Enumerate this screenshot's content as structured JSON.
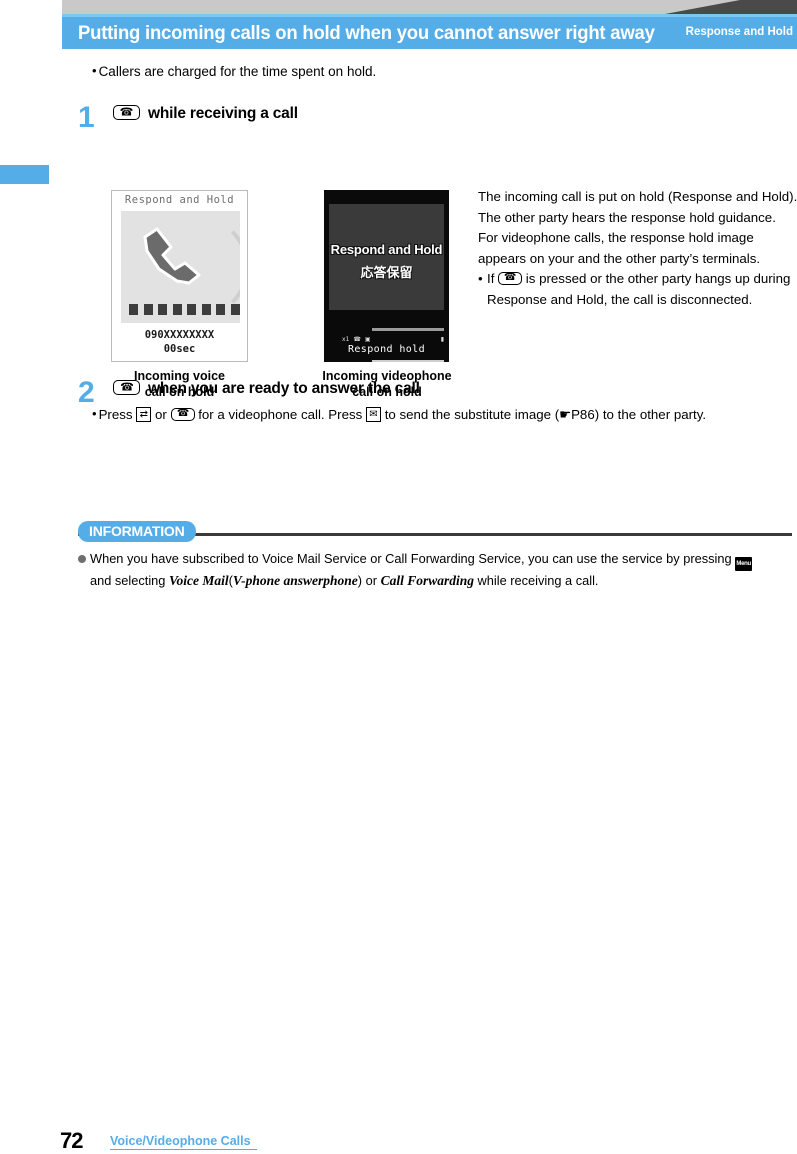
{
  "header": {
    "title": "Putting incoming calls on hold when you cannot answer right away",
    "section_label": "Response and Hold"
  },
  "intro": {
    "bullet": "Callers are charged for the time spent on hold."
  },
  "steps": [
    {
      "number": "1",
      "key_icon": "phone-offhook-key-icon",
      "heading": "while receiving a call"
    },
    {
      "number": "2",
      "key_icon": "phone-answer-key-icon",
      "heading": "when you are ready to answer the call",
      "note_parts": {
        "p1": "Press",
        "p2": "or",
        "p3": "for a videophone call. Press",
        "p4": "to send the substitute image (",
        "ref": "P86",
        "p5": ") to the other party."
      }
    }
  ],
  "screenshots": {
    "voice": {
      "status_title": "Respond and Hold",
      "number": "090XXXXXXXX",
      "duration": "00sec",
      "block_count": 8,
      "caption_line1": "Incoming voice",
      "caption_line2": "call on hold"
    },
    "videophone": {
      "text_en": "Respond and Hold",
      "text_jp": "応答保留",
      "softkey": "Respond hold",
      "status_icons": "x1",
      "caption_line1": "Incoming videophone",
      "caption_line2": "call on hold"
    }
  },
  "right_text": {
    "para1": "The incoming call is put on hold (Response and Hold). The other party hears the response hold guidance.",
    "para2": "For videophone calls, the response hold image appears on your and the other party’s terminals.",
    "bullet_pre": "If",
    "bullet_post": "is pressed or the other party hangs up during Response and Hold, the call is disconnected."
  },
  "information": {
    "tag": "INFORMATION",
    "item_pre": "When you have subscribed to Voice Mail Service or Call Forwarding Service, you can use the service by pressing",
    "menu_key_label": "Menu",
    "item_mid": "and selecting",
    "em1": "Voice Mail",
    "paren_open": "(",
    "em2": "V-phone answerphone",
    "paren_close": ")",
    "item_or": "or",
    "em3": "Call Forwarding",
    "item_end": "while receiving a call."
  },
  "footer": {
    "page_number": "72",
    "chapter": "Voice/Videophone Calls"
  },
  "colors": {
    "accent_blue": "#55ade8",
    "band_gray": "#c9c9c9",
    "band_dark": "#4a4a4a"
  }
}
